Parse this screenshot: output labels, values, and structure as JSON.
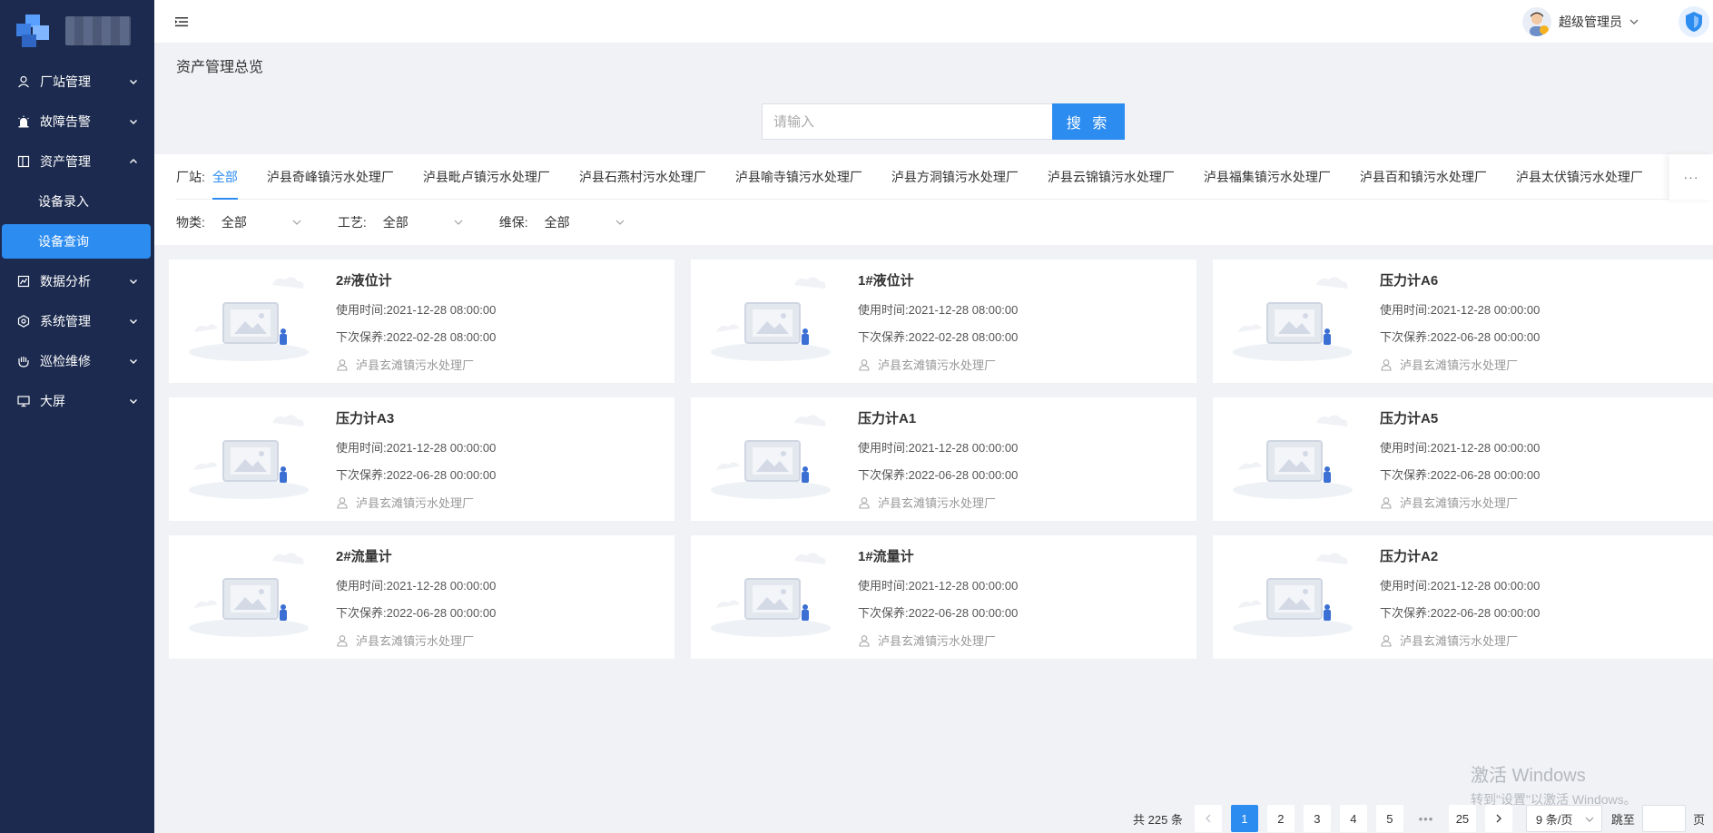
{
  "sidebar": {
    "items": [
      {
        "label": "厂站管理",
        "icon": "user-icon",
        "expanded": false
      },
      {
        "label": "故障告警",
        "icon": "alarm-light-icon",
        "expanded": false
      },
      {
        "label": "资产管理",
        "icon": "book-icon",
        "expanded": true,
        "children": [
          {
            "label": "设备录入",
            "active": false
          },
          {
            "label": "设备查询",
            "active": true
          }
        ]
      },
      {
        "label": "数据分析",
        "icon": "chart-icon",
        "expanded": false
      },
      {
        "label": "系统管理",
        "icon": "settings-hex-icon",
        "expanded": false
      },
      {
        "label": "巡检维修",
        "icon": "hand-icon",
        "expanded": false
      },
      {
        "label": "大屏",
        "icon": "monitor-icon",
        "expanded": false
      }
    ]
  },
  "header": {
    "user_name": "超级管理员"
  },
  "page": {
    "title": "资产管理总览",
    "search_placeholder": "请输入",
    "search_button": "搜 索"
  },
  "filters": {
    "station_label": "厂站:",
    "stations": [
      "全部",
      "泸县奇峰镇污水处理厂",
      "泸县毗卢镇污水处理厂",
      "泸县石燕村污水处理厂",
      "泸县喻寺镇污水处理厂",
      "泸县方洞镇污水处理厂",
      "泸县云锦镇污水处理厂",
      "泸县福集镇污水处理厂",
      "泸县百和镇污水处理厂",
      "泸县太伏镇污水处理厂"
    ],
    "more": "···",
    "selects": [
      {
        "label": "物类:",
        "value": "全部"
      },
      {
        "label": "工艺:",
        "value": "全部"
      },
      {
        "label": "维保:",
        "value": "全部"
      }
    ]
  },
  "cards": [
    {
      "name": "2#液位计",
      "use_label": "使用时间:",
      "use_time": "2021-12-28 08:00:00",
      "next_label": "下次保养:",
      "next_time": "2022-02-28 08:00:00",
      "location": "泸县玄滩镇污水处理厂"
    },
    {
      "name": "1#液位计",
      "use_label": "使用时间:",
      "use_time": "2021-12-28 08:00:00",
      "next_label": "下次保养:",
      "next_time": "2022-02-28 08:00:00",
      "location": "泸县玄滩镇污水处理厂"
    },
    {
      "name": "压力计A6",
      "use_label": "使用时间:",
      "use_time": "2021-12-28 00:00:00",
      "next_label": "下次保养:",
      "next_time": "2022-06-28 00:00:00",
      "location": "泸县玄滩镇污水处理厂"
    },
    {
      "name": "压力计A3",
      "use_label": "使用时间:",
      "use_time": "2021-12-28 00:00:00",
      "next_label": "下次保养:",
      "next_time": "2022-06-28 00:00:00",
      "location": "泸县玄滩镇污水处理厂"
    },
    {
      "name": "压力计A1",
      "use_label": "使用时间:",
      "use_time": "2021-12-28 00:00:00",
      "next_label": "下次保养:",
      "next_time": "2022-06-28 00:00:00",
      "location": "泸县玄滩镇污水处理厂"
    },
    {
      "name": "压力计A5",
      "use_label": "使用时间:",
      "use_time": "2021-12-28 00:00:00",
      "next_label": "下次保养:",
      "next_time": "2022-06-28 00:00:00",
      "location": "泸县玄滩镇污水处理厂"
    },
    {
      "name": "2#流量计",
      "use_label": "使用时间:",
      "use_time": "2021-12-28 00:00:00",
      "next_label": "下次保养:",
      "next_time": "2022-06-28 00:00:00",
      "location": "泸县玄滩镇污水处理厂"
    },
    {
      "name": "1#流量计",
      "use_label": "使用时间:",
      "use_time": "2021-12-28 00:00:00",
      "next_label": "下次保养:",
      "next_time": "2022-06-28 00:00:00",
      "location": "泸县玄滩镇污水处理厂"
    },
    {
      "name": "压力计A2",
      "use_label": "使用时间:",
      "use_time": "2021-12-28 00:00:00",
      "next_label": "下次保养:",
      "next_time": "2022-06-28 00:00:00",
      "location": "泸县玄滩镇污水处理厂"
    }
  ],
  "pagination": {
    "total": "共 225 条",
    "pages": [
      "1",
      "2",
      "3",
      "4",
      "5"
    ],
    "ellipsis": "•••",
    "last": "25",
    "current": "1",
    "page_size": "9 条/页",
    "jump_label": "跳至",
    "jump_unit": "页"
  },
  "watermark": {
    "line1": "激活 Windows",
    "line2": "转到\"设置\"以激活 Windows。"
  },
  "colors": {
    "sidebar_bg": "#1b2a4e",
    "accent": "#2d8cf0"
  }
}
